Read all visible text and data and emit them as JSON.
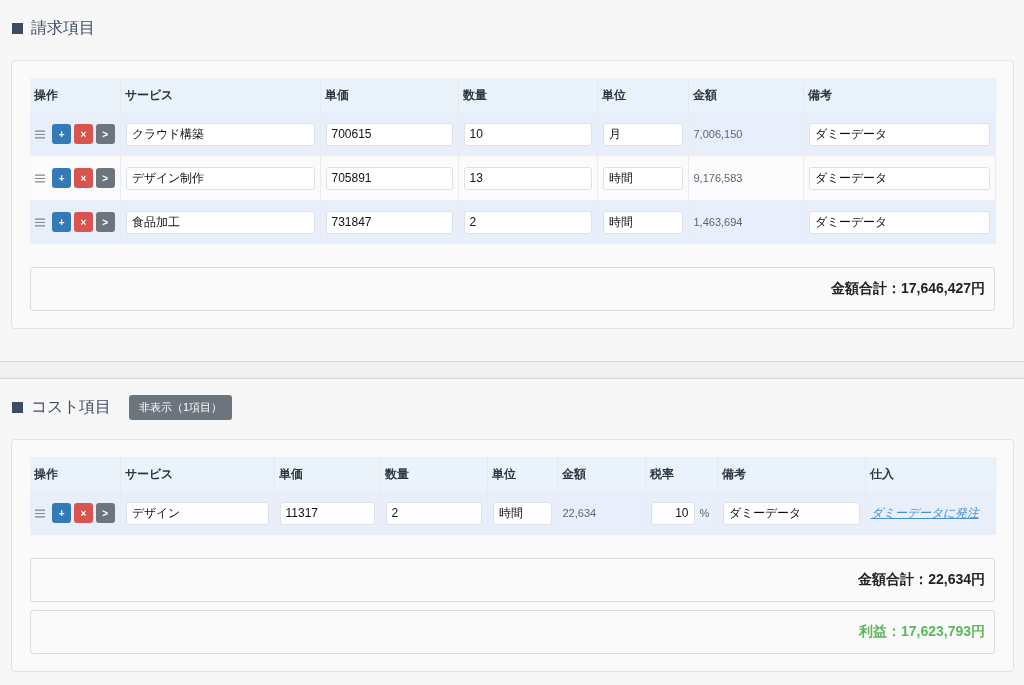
{
  "sections": [
    {
      "title": "請求項目",
      "columns": [
        {
          "label": "操作",
          "kind": "ops"
        },
        {
          "label": "サービス",
          "kind": "input"
        },
        {
          "label": "単価",
          "kind": "input"
        },
        {
          "label": "数量",
          "kind": "input"
        },
        {
          "label": "単位",
          "kind": "input"
        },
        {
          "label": "金額",
          "kind": "amount"
        },
        {
          "label": "備考",
          "kind": "input"
        }
      ],
      "rows": [
        {
          "cells": [
            {
              "actions": [
                {
                  "kind": "add",
                  "label": "+"
                },
                {
                  "kind": "delete",
                  "label": "×"
                },
                {
                  "kind": "next",
                  "label": ">"
                }
              ]
            },
            {
              "value": "クラウド構築"
            },
            {
              "value": "700615"
            },
            {
              "value": "10"
            },
            {
              "value": "月"
            },
            {
              "value": "7,006,150"
            },
            {
              "value": "ダミーデータ"
            }
          ]
        },
        {
          "cells": [
            {
              "actions": [
                {
                  "kind": "add",
                  "label": "+"
                },
                {
                  "kind": "delete",
                  "label": "×"
                },
                {
                  "kind": "next",
                  "label": ">"
                }
              ]
            },
            {
              "value": "デザイン制作"
            },
            {
              "value": "705891"
            },
            {
              "value": "13"
            },
            {
              "value": "時間"
            },
            {
              "value": "9,176,583"
            },
            {
              "value": "ダミーデータ"
            }
          ]
        },
        {
          "cells": [
            {
              "actions": [
                {
                  "kind": "add",
                  "label": "+"
                },
                {
                  "kind": "delete",
                  "label": "×"
                },
                {
                  "kind": "next",
                  "label": ">"
                }
              ]
            },
            {
              "value": "食品加工"
            },
            {
              "value": "731847"
            },
            {
              "value": "2"
            },
            {
              "value": "時間"
            },
            {
              "value": "1,463,694"
            },
            {
              "value": "ダミーデータ"
            }
          ]
        }
      ],
      "summaries": [
        {
          "kind": "total",
          "text": "金額合計：17,646,427円"
        }
      ]
    },
    {
      "title": "コスト項目",
      "toggle_button": "非表示（1項目）",
      "columns": [
        {
          "label": "操作",
          "kind": "ops"
        },
        {
          "label": "サービス",
          "kind": "input"
        },
        {
          "label": "単価",
          "kind": "input"
        },
        {
          "label": "数量",
          "kind": "input"
        },
        {
          "label": "単位",
          "kind": "input"
        },
        {
          "label": "金額",
          "kind": "amount"
        },
        {
          "label": "税率",
          "kind": "tax"
        },
        {
          "label": "備考",
          "kind": "input"
        },
        {
          "label": "仕入",
          "kind": "link"
        }
      ],
      "rows": [
        {
          "cells": [
            {
              "actions": [
                {
                  "kind": "add",
                  "label": "+"
                },
                {
                  "kind": "delete",
                  "label": "×"
                },
                {
                  "kind": "next",
                  "label": ">"
                }
              ]
            },
            {
              "value": "デザイン"
            },
            {
              "value": "11317"
            },
            {
              "value": "2"
            },
            {
              "value": "時間"
            },
            {
              "value": "22,634"
            },
            {
              "value": "10",
              "suffix": "%"
            },
            {
              "value": "ダミーデータ"
            },
            {
              "value": "ダミーデータに発注"
            }
          ]
        }
      ],
      "summaries": [
        {
          "kind": "total",
          "text": "金額合計：22,634円"
        },
        {
          "kind": "profit",
          "text": "利益：17,623,793円"
        }
      ]
    }
  ]
}
